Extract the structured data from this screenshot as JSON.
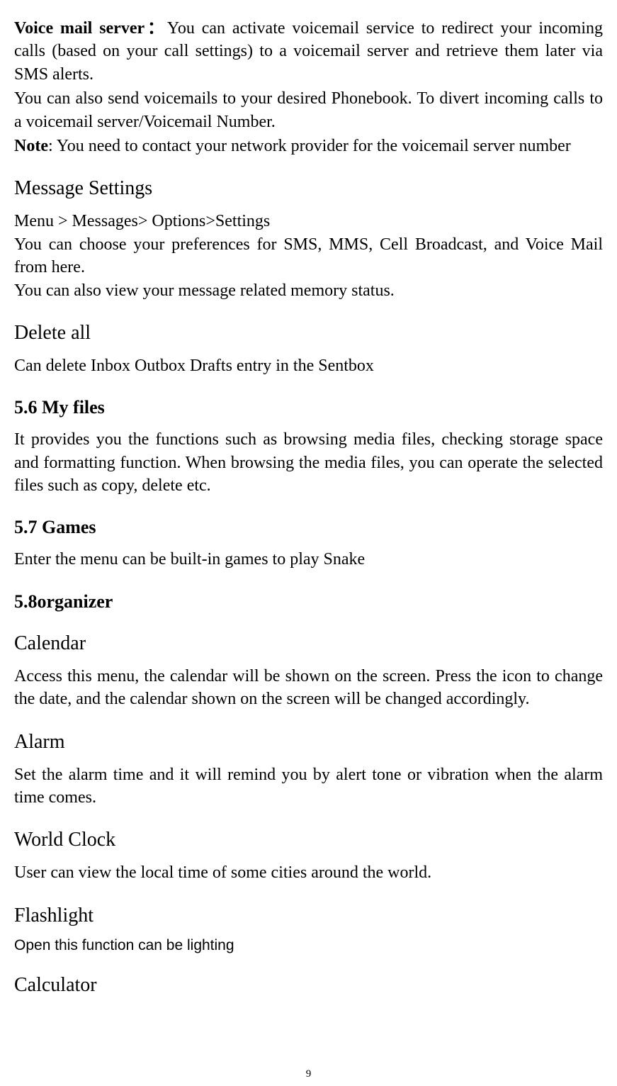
{
  "voicemail": {
    "label": "Voice mail server：",
    "text1": "You can activate voicemail service to redirect your incoming calls (based on your call settings) to a voicemail server and retrieve them later via SMS alerts.",
    "text2": "You can also send voicemails to your desired Phonebook. To divert incoming calls to a voicemail server/Voicemail Number.",
    "note_label": "Note",
    "note_text": ": You need to contact your network provider for the voicemail server number"
  },
  "message_settings": {
    "heading": "Message Settings",
    "path": "Menu > Messages> Options>Settings",
    "text1": "You can choose your preferences for SMS, MMS, Cell Broadcast, and Voice Mail from here.",
    "text2": "You can also view your message related memory status."
  },
  "delete_all": {
    "heading": "Delete all",
    "text": "Can delete Inbox Outbox Drafts entry in the Sentbox"
  },
  "my_files": {
    "heading": "5.6 My files",
    "text": "It provides you the functions such as browsing media files, checking storage space and formatting function. When browsing the media files, you can operate the selected files such as copy, delete etc."
  },
  "games": {
    "heading": "5.7 Games",
    "text": "Enter the menu can be built-in games to play Snake"
  },
  "organizer": {
    "heading": "5.8organizer"
  },
  "calendar": {
    "heading": "Calendar",
    "text": "Access this menu, the calendar will be shown on the screen. Press the icon to change the date, and the calendar shown on the screen will be changed accordingly."
  },
  "alarm": {
    "heading": "Alarm",
    "text": "Set the alarm time and it will remind you by alert tone or vibration when the alarm time comes."
  },
  "world_clock": {
    "heading": "World Clock",
    "text": "User can view the local time of some cities around the world."
  },
  "flashlight": {
    "heading": "Flashlight",
    "text": "Open this function can be lighting"
  },
  "calculator": {
    "heading": "Calculator"
  },
  "page_number": "9"
}
